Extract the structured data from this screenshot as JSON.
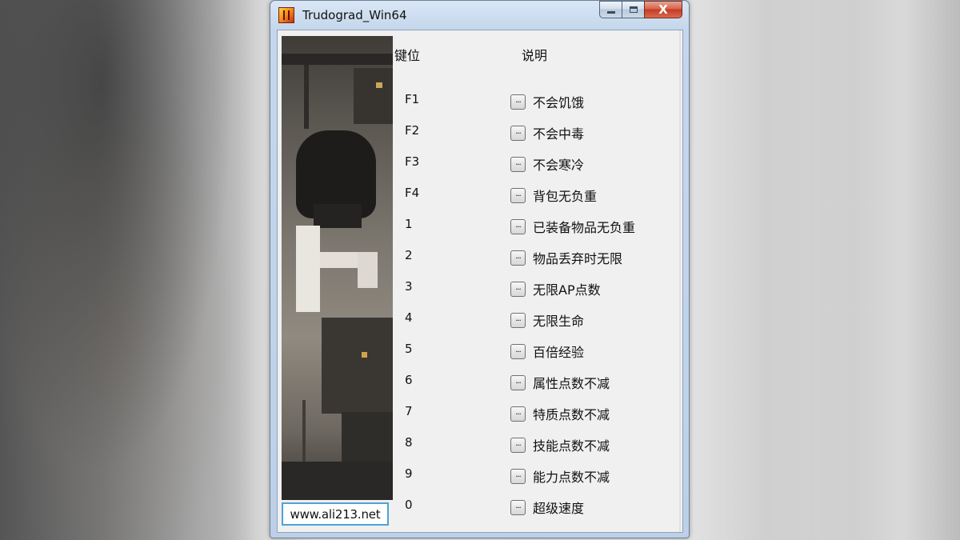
{
  "window": {
    "title": "Trudograd_Win64",
    "controls": {
      "minimize_icon": "minimize-icon",
      "maximize_icon": "maximize-icon",
      "close_glyph": "X"
    }
  },
  "headers": {
    "key": "键位",
    "description": "说明"
  },
  "rows": [
    {
      "key": "F1",
      "button": "...",
      "label": "不会饥饿"
    },
    {
      "key": "F2",
      "button": "...",
      "label": "不会中毒"
    },
    {
      "key": "F3",
      "button": "...",
      "label": "不会寒冷"
    },
    {
      "key": "F4",
      "button": "...",
      "label": "背包无负重"
    },
    {
      "key": "1",
      "button": "...",
      "label": "已装备物品无负重"
    },
    {
      "key": "2",
      "button": "...",
      "label": "物品丢弃时无限"
    },
    {
      "key": "3",
      "button": "...",
      "label": "无限AP点数"
    },
    {
      "key": "4",
      "button": "...",
      "label": "无限生命"
    },
    {
      "key": "5",
      "button": "...",
      "label": "百倍经验"
    },
    {
      "key": "6",
      "button": "...",
      "label": "属性点数不减"
    },
    {
      "key": "7",
      "button": "...",
      "label": "特质点数不减"
    },
    {
      "key": "8",
      "button": "...",
      "label": "技能点数不减"
    },
    {
      "key": "9",
      "button": "...",
      "label": "能力点数不减"
    },
    {
      "key": "0",
      "button": "...",
      "label": "超级速度"
    }
  ],
  "footer": {
    "url": "www.ali213.net"
  }
}
